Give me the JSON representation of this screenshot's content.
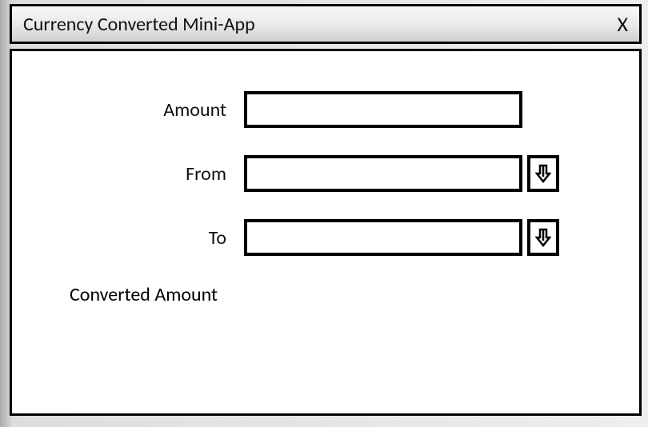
{
  "titlebar": {
    "title": "Currency Converted Mini-App",
    "close_label": "X"
  },
  "form": {
    "amount_label": "Amount",
    "amount_value": "",
    "from_label": "From",
    "from_value": "",
    "to_label": "To",
    "to_value": "",
    "converted_label": "Converted Amount",
    "converted_value": ""
  },
  "icons": {
    "dropdown": "arrow-down-icon"
  }
}
